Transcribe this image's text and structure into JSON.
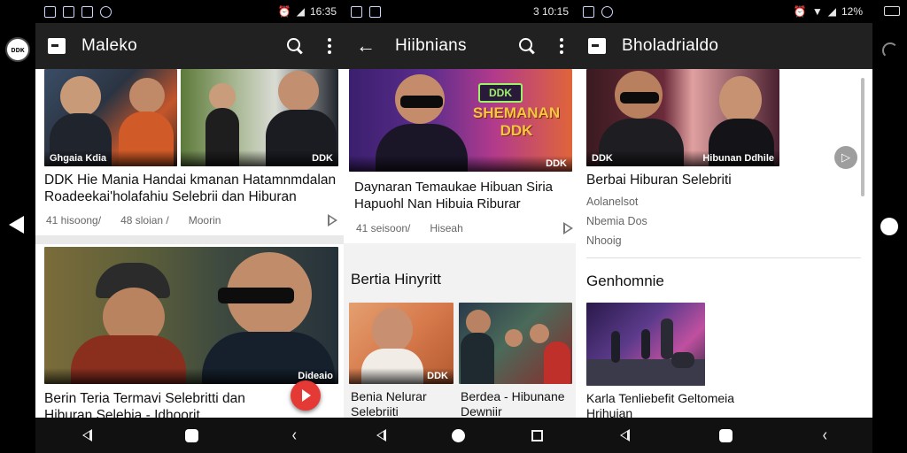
{
  "status_bar": {
    "left_time": "16:35",
    "mid_time": "3 10:15",
    "right_time": "12%"
  },
  "left_edge": {
    "avatar_label": "ᴅᴅᴋ"
  },
  "panel1": {
    "title": "Maleko",
    "card1": {
      "thumb1_caption": "Ghgaia Kdia",
      "thumb2_caption": "DDK",
      "headline": "DDK Hie Mania Handai kmanan Hatamnmdalan Roadeekai'holafahiu Selebrii dan Hiburan",
      "meta_views": "41 hisoong/",
      "meta_age": "48 sloian /",
      "meta_channel": "Moorin"
    },
    "card2": {
      "thumb_caption": "Dideaio",
      "headline": "Berin Teria Termavi Selebritti dan Hiburan Selebia - Idhoorit"
    }
  },
  "panel2": {
    "title": "Hiibnians",
    "hero": {
      "badge": "DDK",
      "art_text": "SHEMANAN DDK",
      "caption": "DDK",
      "headline": "Daynaran Temaukae Hibuan Siria Hapuohl Nan Hibuia Riburar",
      "meta_views": "41 seisoon/",
      "meta_channel": "Hiseah"
    },
    "section_title": "Bertia Hinyritt",
    "grid": [
      {
        "caption": "DDK",
        "title": "Benia Nelurar Selebriiti"
      },
      {
        "caption": "",
        "title": "Berdea - Hibunane Dewniir"
      }
    ]
  },
  "panel3": {
    "title": "Bholadrialdo",
    "hero": {
      "caption_left": "DDK",
      "caption_right": "Hibunan Ddhile"
    },
    "headline": "Berbai Hiburan Selebriti",
    "sub1": "Aolanelsot",
    "sub2": "Nbemia Dos",
    "sub3": "Nhooig",
    "section_title": "Genhomnie",
    "card_title": "Karla Tenliebefit Geltomeia Hrihuian"
  }
}
